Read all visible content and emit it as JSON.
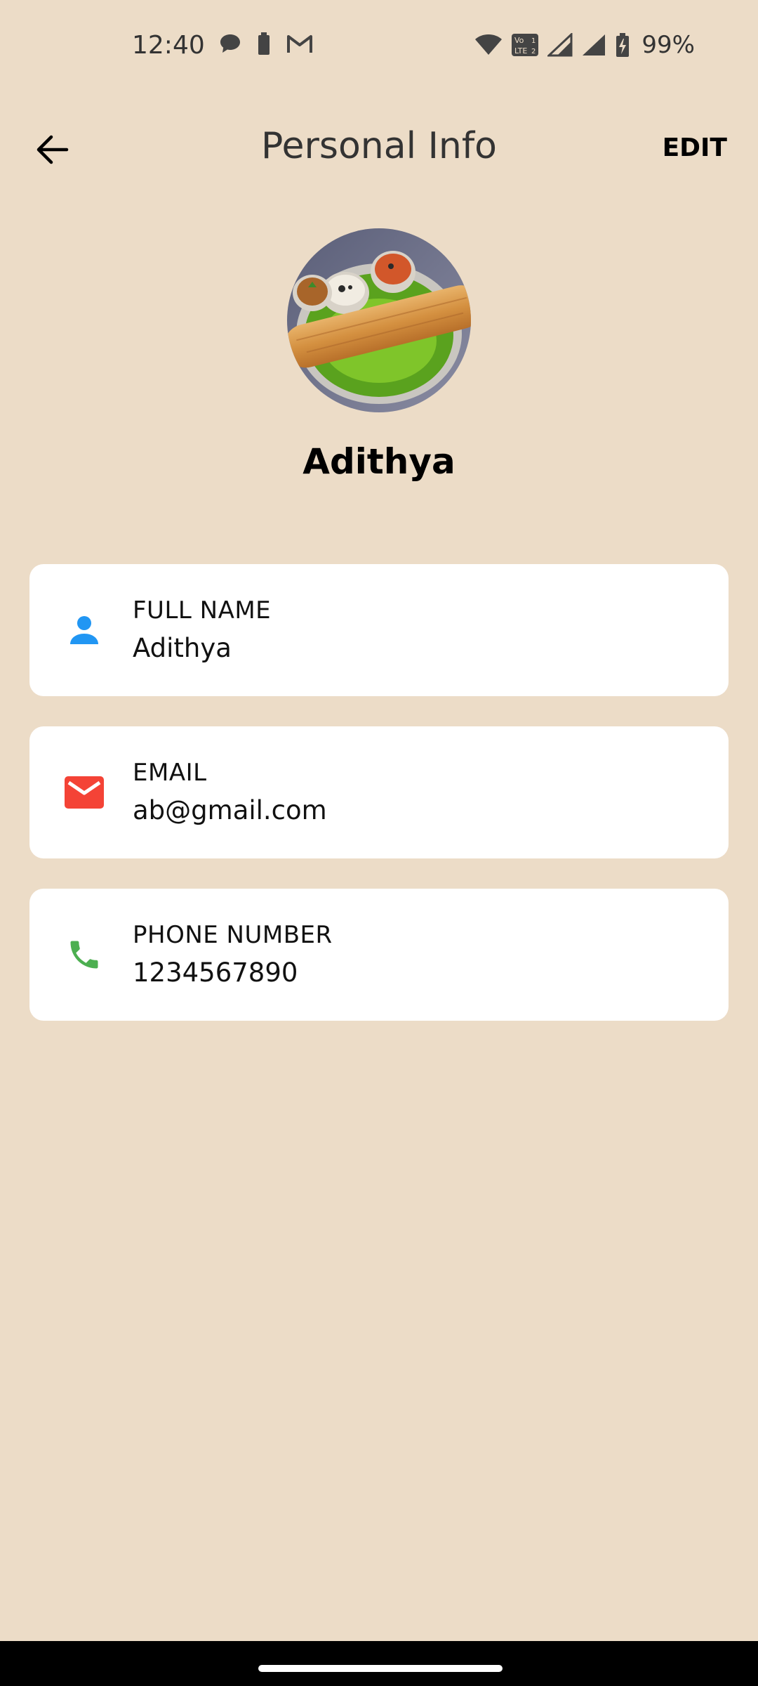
{
  "status_bar": {
    "time": "12:40",
    "battery": "99%",
    "left_icons": [
      "chat-bubble-icon",
      "battery-small-icon",
      "gmail-icon"
    ],
    "right_icons": [
      "wifi-icon",
      "volte-icon",
      "signal-icon",
      "signal-icon",
      "battery-charging-icon"
    ]
  },
  "app_bar": {
    "title": "Personal Info",
    "edit_label": "EDIT",
    "back_icon": "arrow-back-icon"
  },
  "profile": {
    "name": "Adithya",
    "avatar": "dosa-food-photo"
  },
  "fields": [
    {
      "label": "FULL NAME",
      "value": "Adithya",
      "icon": "person-icon",
      "icon_color": "#2196f3"
    },
    {
      "label": "EMAIL",
      "value": "ab@gmail.com",
      "icon": "mail-icon",
      "icon_color": "#f44336"
    },
    {
      "label": "PHONE NUMBER",
      "value": "1234567890",
      "icon": "phone-icon",
      "icon_color": "#4caf50"
    }
  ],
  "colors": {
    "background": "#ecdcc7",
    "card": "#ffffff"
  }
}
